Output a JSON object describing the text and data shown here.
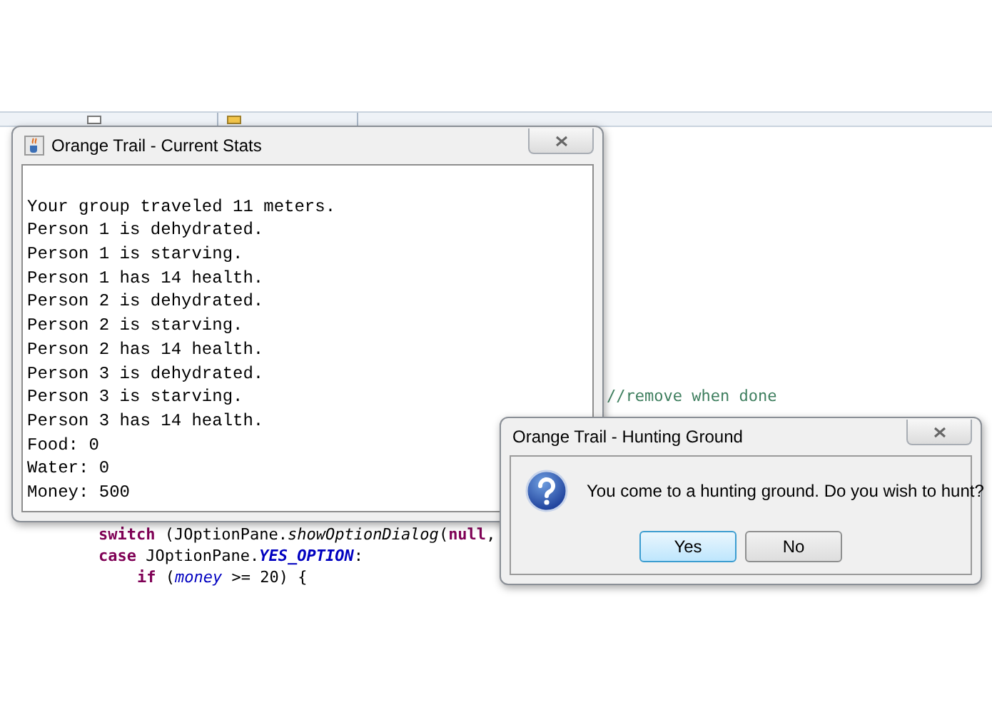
{
  "editor": {
    "code_lines": [
      {
        "segments": [
          {
            "text": "//remove when done",
            "kind": "comment"
          }
        ]
      },
      {
        "segments": [
          {
            "text": "switch",
            "kind": "keyword"
          },
          {
            "text": " (JOptionPane.",
            "kind": "plain"
          },
          {
            "text": "showOptionDialog",
            "kind": "static"
          },
          {
            "text": "(",
            "kind": "plain"
          },
          {
            "text": "null",
            "kind": "keyword"
          },
          {
            "text": ", ",
            "kind": "plain"
          }
        ]
      },
      {
        "segments": [
          {
            "text": "case",
            "kind": "keyword"
          },
          {
            "text": " JOptionPane.",
            "kind": "plain"
          },
          {
            "text": "YES_OPTION",
            "kind": "constant"
          },
          {
            "text": ":",
            "kind": "plain"
          }
        ]
      },
      {
        "segments": [
          {
            "text": "if",
            "kind": "keyword"
          },
          {
            "text": " (",
            "kind": "plain"
          },
          {
            "text": "money",
            "kind": "field"
          },
          {
            "text": " >= 20) {",
            "kind": "plain"
          }
        ]
      }
    ]
  },
  "stats_window": {
    "title": "Orange Trail - Current Stats",
    "lines": [
      "Your group traveled 11 meters.",
      "Person 1 is dehydrated.",
      "Person 1 is starving.",
      "Person 1 has 14 health.",
      "Person 2 is dehydrated.",
      "Person 2 is starving.",
      "Person 2 has 14 health.",
      "Person 3 is dehydrated.",
      "Person 3 is starving.",
      "Person 3 has 14 health.",
      "Food: 0",
      "Water: 0",
      "Money: 500"
    ]
  },
  "dialog": {
    "title": "Orange Trail - Hunting Ground",
    "message": "You come to a hunting ground. Do you wish to hunt?",
    "buttons": [
      {
        "label": "Yes",
        "focused": true
      },
      {
        "label": "No",
        "focused": false
      }
    ]
  }
}
